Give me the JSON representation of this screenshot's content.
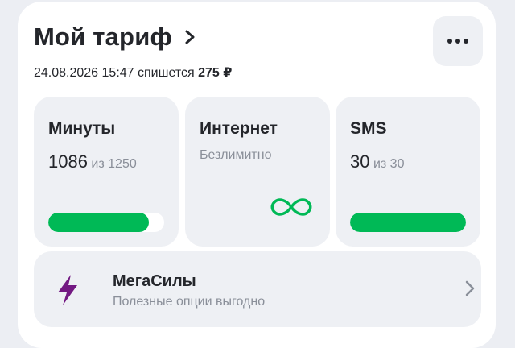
{
  "tariff": {
    "title": "Мой тариф",
    "charge_datetime": "24.08.2026 15:47",
    "charge_text": "спишется",
    "charge_amount": "275 ₽"
  },
  "tiles": {
    "minutes": {
      "title": "Минуты",
      "used": "1086",
      "of_label": "из",
      "total": "1250",
      "bar_fill_fraction": 0.87
    },
    "internet": {
      "title": "Интернет",
      "subtitle": "Безлимитно",
      "icon": "infinity-icon"
    },
    "sms": {
      "title": "SMS",
      "used": "30",
      "of_label": "из",
      "total": "30",
      "bar_fill_fraction": 1.0
    }
  },
  "options": {
    "title": "МегаСилы",
    "subtitle": "Полезные опции выгодно",
    "icon": "lightning-icon"
  },
  "colors": {
    "accent_green": "#00b956",
    "bolt_purple": "#731982",
    "tile_bg": "#eef0f4"
  }
}
